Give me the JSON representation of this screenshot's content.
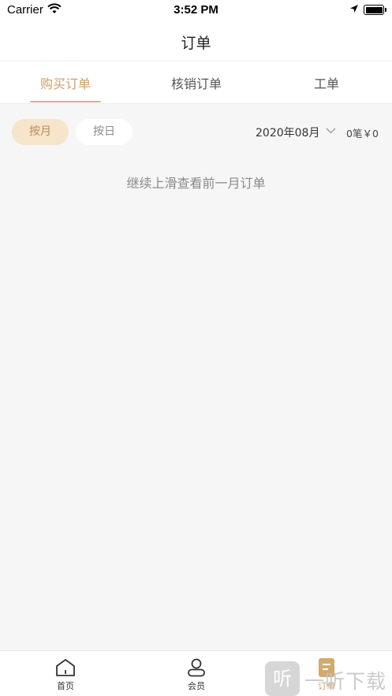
{
  "status_bar": {
    "carrier": "Carrier",
    "time": "3:52 PM"
  },
  "nav": {
    "title": "订单"
  },
  "tabs": [
    {
      "label": "购买订单",
      "active": true
    },
    {
      "label": "核销订单",
      "active": false
    },
    {
      "label": "工单",
      "active": false
    }
  ],
  "filters": {
    "month_label": "按月",
    "day_label": "按日",
    "selected_mode": "按月",
    "date_value": "2020年08月",
    "summary": "0笔￥0"
  },
  "content": {
    "hint": "继续上滑查看前一月订单"
  },
  "bottom_tabs": [
    {
      "label": "首页",
      "icon": "home-icon"
    },
    {
      "label": "会员",
      "icon": "member-icon"
    },
    {
      "label": "订单",
      "icon": "order-icon",
      "active": true
    }
  ],
  "watermark": {
    "glyph": "听",
    "text": "一听下载"
  },
  "colors": {
    "accent": "#c9a26a",
    "chip_active_bg": "#f6e4cb",
    "background": "#f6f6f6"
  }
}
